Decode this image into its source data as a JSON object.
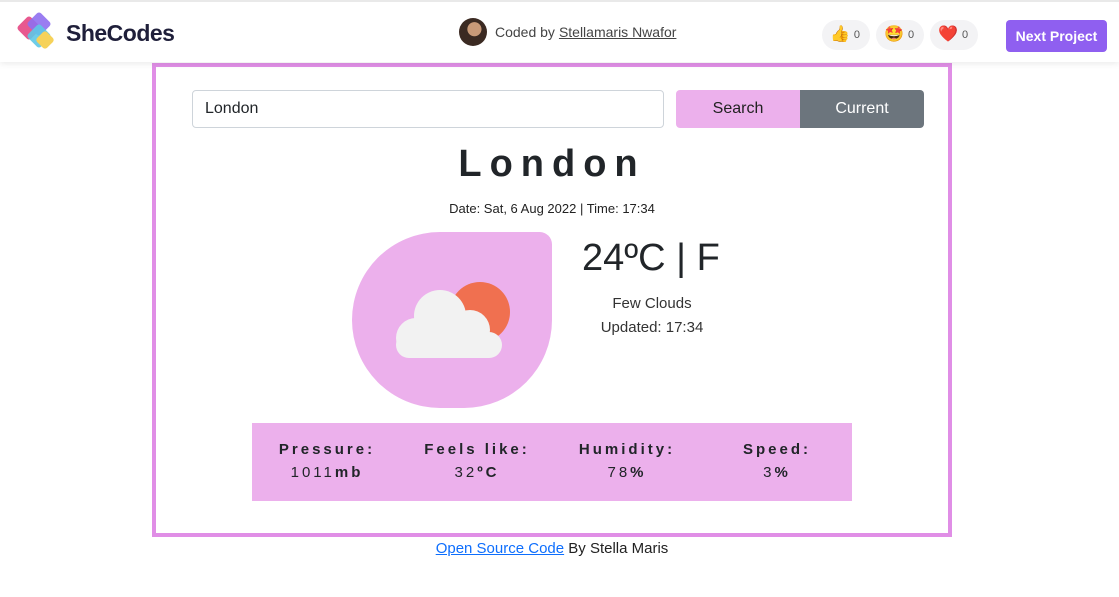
{
  "topbar": {
    "logo_text": "SheCodes",
    "coded_by_prefix": "Coded by",
    "author_name": "Stellamaris Nwafor",
    "reactions": [
      {
        "icon": "thumbs-up-icon",
        "glyph": "👍",
        "count": "0"
      },
      {
        "icon": "star-eyes-icon",
        "glyph": "🤩",
        "count": "0"
      },
      {
        "icon": "heart-icon",
        "glyph": "❤️",
        "count": "0"
      }
    ],
    "next_label": "Next Project"
  },
  "search": {
    "value": "London",
    "search_label": "Search",
    "current_label": "Current"
  },
  "weather": {
    "city": "London",
    "datetime": "Date: Sat, 6 Aug 2022 | Time: 17:34",
    "temp": "24ºC | F",
    "description": "Few Clouds",
    "updated": "Updated: 17:34",
    "icon": "few-clouds-icon"
  },
  "stats": [
    {
      "label": "Pressure:",
      "value": "1011",
      "unit": "mb"
    },
    {
      "label": "Feels like:",
      "value": "32",
      "unit": "ºC"
    },
    {
      "label": "Humidity:",
      "value": "78",
      "unit": "%"
    },
    {
      "label": "Speed:",
      "value": "3",
      "unit": "%"
    }
  ],
  "footer": {
    "link_text": "Open Source Code",
    "suffix": " By Stella Maris"
  },
  "colors": {
    "accent_pink": "#ecb0ec",
    "border_pink": "#e08ee6",
    "next_purple": "#8f5ff0",
    "current_gray": "#6c757d"
  }
}
